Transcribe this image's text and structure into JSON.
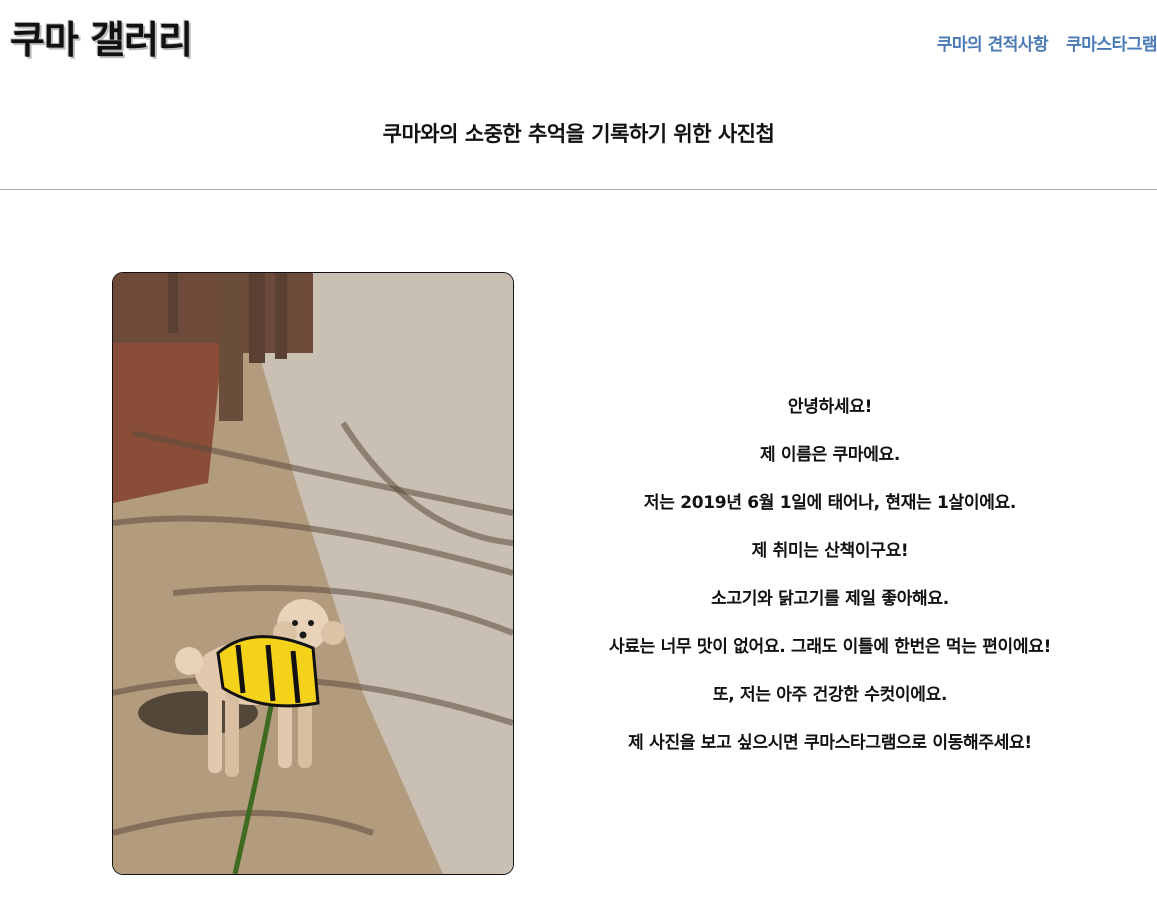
{
  "header": {
    "logo": "쿠마 갤러리",
    "nav": [
      {
        "label": "쿠마의 견적사항"
      },
      {
        "label": "쿠마스타그램"
      }
    ]
  },
  "subtitle": "쿠마와의 소중한 추억을 기록하기 위한 사진첩",
  "intro": {
    "lines": [
      "안녕하세요!",
      "제 이름은 쿠마에요.",
      "저는 2019년 6월 1일에 태어나, 현재는 1살이에요.",
      "제 취미는 산책이구요!",
      "소고기와 닭고기를 제일 좋아해요.",
      "사료는 너무 맛이 없어요. 그래도 이틀에 한번은 먹는 편이에요!",
      "또, 저는 아주 건강한 수컷이에요.",
      "제 사진을 보고 싶으시면 쿠마스타그램으로 이동해주세요!"
    ]
  },
  "colors": {
    "nav": "#4a7ab5",
    "divider": "#a9a9a9",
    "text": "#111111"
  },
  "photo": {
    "subject": "dog-photo"
  }
}
